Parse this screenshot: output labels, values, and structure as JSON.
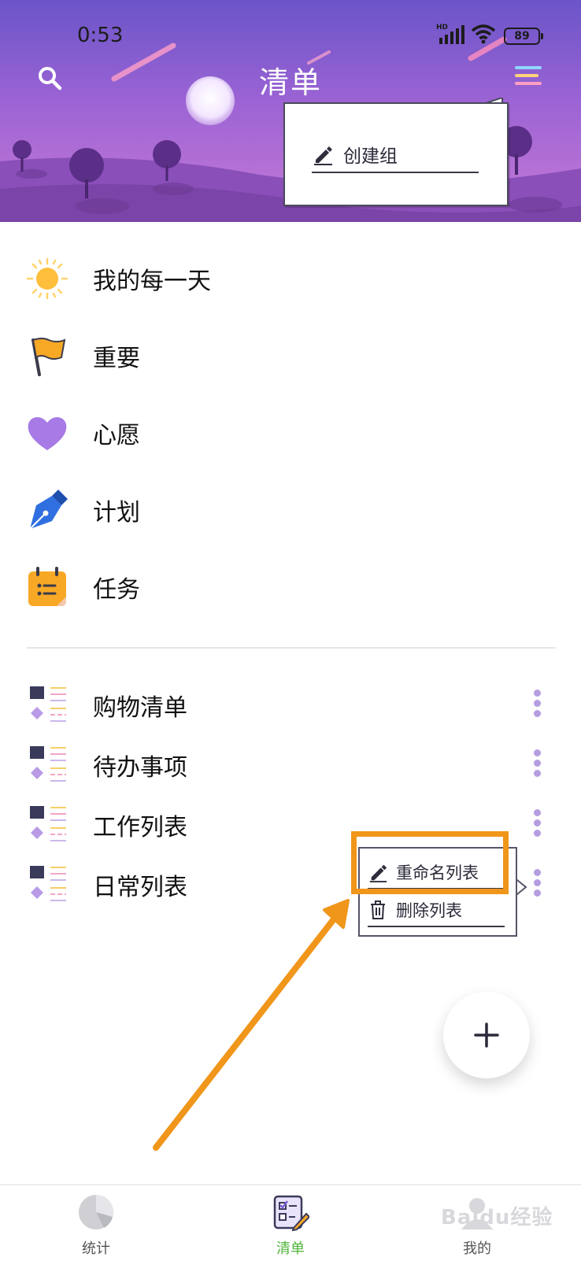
{
  "status_bar": {
    "time": "0:53",
    "network": "HD",
    "battery": "89"
  },
  "header": {
    "title": "清单",
    "search_icon": "search-icon",
    "menu_icon": "menu-icon",
    "colors": {
      "top": "#6a55c8",
      "bottom": "#c77ad6"
    }
  },
  "header_popup": {
    "items": [
      {
        "label": "创建组",
        "icon": "pencil-icon"
      }
    ]
  },
  "smart_lists": [
    {
      "label": "我的每一天",
      "icon": "sun-icon"
    },
    {
      "label": "重要",
      "icon": "flag-icon"
    },
    {
      "label": "心愿",
      "icon": "heart-icon"
    },
    {
      "label": "计划",
      "icon": "pen-nib-icon"
    },
    {
      "label": "任务",
      "icon": "calendar-icon"
    }
  ],
  "custom_lists": [
    {
      "label": "购物清单",
      "icon": "list-icon"
    },
    {
      "label": "待办事项",
      "icon": "list-icon"
    },
    {
      "label": "工作列表",
      "icon": "list-icon"
    },
    {
      "label": "日常列表",
      "icon": "list-icon"
    }
  ],
  "list_popup": {
    "rename": {
      "label": "重命名列表",
      "icon": "pencil-icon"
    },
    "delete": {
      "label": "删除列表",
      "icon": "trash-icon"
    },
    "highlight_color": "#f0961a"
  },
  "fab": {
    "icon": "plus-icon"
  },
  "bottom_nav": [
    {
      "label": "统计",
      "icon": "pie-chart-icon",
      "active": false
    },
    {
      "label": "清单",
      "icon": "checklist-icon",
      "active": true
    },
    {
      "label": "我的",
      "icon": "profile-icon",
      "active": false
    }
  ],
  "watermark": {
    "text": "Baidu经验"
  },
  "accent_color": "#4fb53a"
}
